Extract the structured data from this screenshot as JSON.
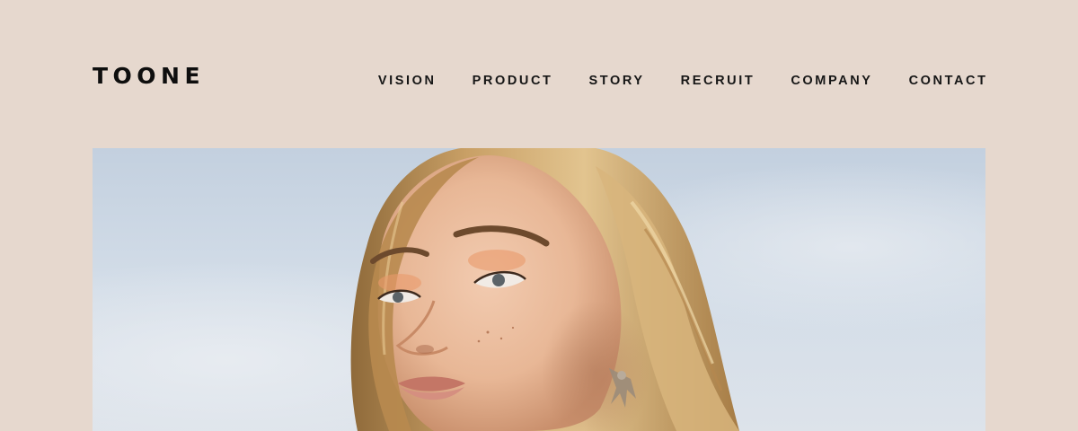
{
  "header": {
    "logo": "TOONE",
    "nav": [
      {
        "label": "VISION"
      },
      {
        "label": "PRODUCT"
      },
      {
        "label": "STORY"
      },
      {
        "label": "RECRUIT"
      },
      {
        "label": "COMPANY"
      },
      {
        "label": "CONTACT"
      }
    ]
  },
  "colors": {
    "background": "#e6d8ce",
    "text": "#161616",
    "sky": "#d5dfea",
    "hair": "#c69a5a",
    "skin": "#ecc2a6"
  },
  "hero": {
    "image_subject": "portrait-photo"
  }
}
